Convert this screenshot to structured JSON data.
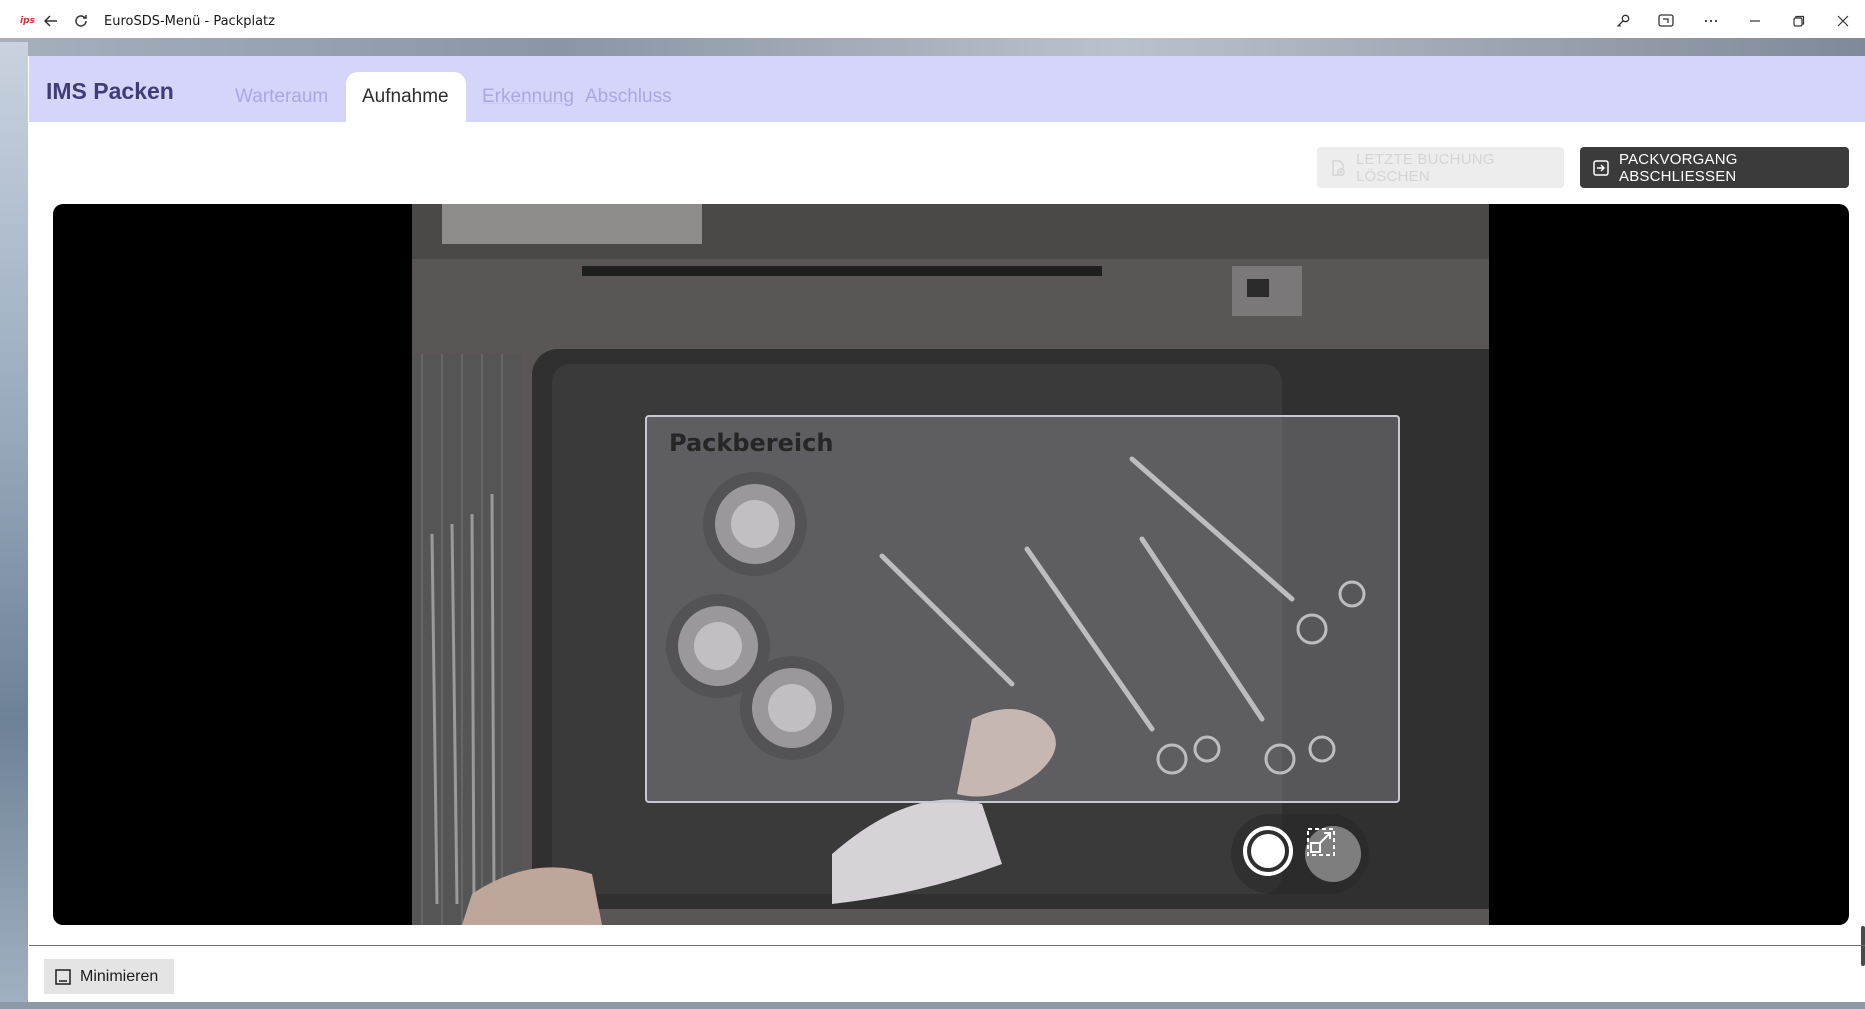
{
  "window": {
    "logo_text": "ips",
    "title": "EuroSDS-Menü - Packplatz",
    "icons": [
      "back-icon",
      "reload-icon",
      "key-icon",
      "screen-cast-icon",
      "more-icon",
      "minimize-icon",
      "restore-icon",
      "close-icon"
    ]
  },
  "app": {
    "brand": "IMS Packen",
    "tabs": [
      {
        "label": "Warteraum",
        "active": false
      },
      {
        "label": "Aufnahme",
        "active": true
      },
      {
        "label": "Erkennung",
        "active": false
      },
      {
        "label": "Abschluss",
        "active": false
      }
    ]
  },
  "actions": {
    "delete_last": "LETZTE BUCHUNG LÖSCHEN",
    "delete_last_icon": "delete-document-icon",
    "delete_last_enabled": false,
    "finish": "PACKVORGANG ABSCHLIESSEN",
    "finish_icon": "exit-icon"
  },
  "camera": {
    "area_label": "Packbereich",
    "controls": [
      "capture-shutter-icon",
      "fit-to-area-icon"
    ]
  },
  "footer": {
    "minimize_label": "Minimieren",
    "minimize_icon": "minimize-panel-icon"
  },
  "colors": {
    "header_bg": "#d5d4fb",
    "brand": "#3f3d77",
    "tab_inactive": "#aaa8e2",
    "primary_button": "#3b3b3b",
    "disabled_button": "#ededed"
  }
}
